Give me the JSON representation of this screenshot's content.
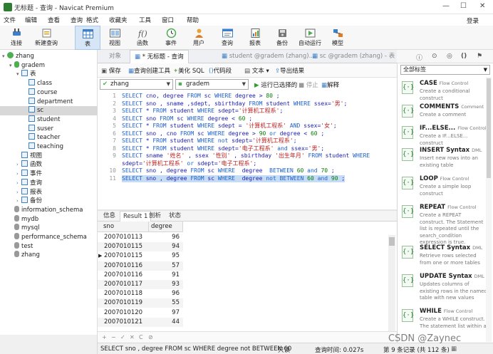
{
  "window": {
    "title": "无标题 - 查询 - Navicat Premium"
  },
  "menu": [
    "文件",
    "编辑",
    "查看",
    "查询",
    "格式",
    "收藏夹",
    "工具",
    "窗口",
    "帮助"
  ],
  "login_label": "登录",
  "toolbar": [
    {
      "label": "连接",
      "icon": "plug-icon"
    },
    {
      "label": "新建查询",
      "icon": "new-query-icon"
    },
    {
      "label": "表",
      "icon": "table-icon"
    },
    {
      "label": "视图",
      "icon": "view-icon"
    },
    {
      "label": "函数",
      "icon": "function-icon"
    },
    {
      "label": "事件",
      "icon": "clock-icon"
    },
    {
      "label": "用户",
      "icon": "user-icon"
    },
    {
      "label": "查询",
      "icon": "query-icon"
    },
    {
      "label": "报表",
      "icon": "report-icon"
    },
    {
      "label": "备份",
      "icon": "backup-icon"
    },
    {
      "label": "自动运行",
      "icon": "autorun-icon"
    },
    {
      "label": "模型",
      "icon": "model-icon"
    }
  ],
  "sidebar": {
    "items": [
      {
        "label": "zhang",
        "level": 0
      },
      {
        "label": "gradem",
        "level": 1
      },
      {
        "label": "表",
        "level": 2
      },
      {
        "label": "class",
        "level": 3
      },
      {
        "label": "course",
        "level": 3
      },
      {
        "label": "department",
        "level": 3
      },
      {
        "label": "sc",
        "level": 3
      },
      {
        "label": "student",
        "level": 3
      },
      {
        "label": "suser",
        "level": 3
      },
      {
        "label": "teacher",
        "level": 3
      },
      {
        "label": "teaching",
        "level": 3
      },
      {
        "label": "视图",
        "level": 2
      },
      {
        "label": "函数",
        "level": 2
      },
      {
        "label": "事件",
        "level": 2
      },
      {
        "label": "查询",
        "level": 2
      },
      {
        "label": "报表",
        "level": 2
      },
      {
        "label": "备份",
        "level": 2
      },
      {
        "label": "information_schema",
        "level": 1
      },
      {
        "label": "mydb",
        "level": 1
      },
      {
        "label": "mysql",
        "level": 1
      },
      {
        "label": "performance_schema",
        "level": 1
      },
      {
        "label": "test",
        "level": 1
      },
      {
        "label": "zhang",
        "level": 1
      }
    ]
  },
  "tabs": [
    "对象",
    "* 无标题 - 查询",
    "student @gradem (zhang)...",
    "sc @gradem (zhang) - 表"
  ],
  "query_toolbar": {
    "save": "保存",
    "builder": "查询创建工具",
    "beautify": "美化 SQL",
    "snippet": "代码段",
    "text": "文本",
    "export": "导出结果",
    "run_selected": "运行已选择的",
    "stop": "停止",
    "explain": "解释"
  },
  "selectors": {
    "connection": "zhang",
    "database": "gradem"
  },
  "editor": {
    "line_numbers": [
      "1",
      "2",
      "3",
      "4",
      "5",
      "6",
      "7",
      "8",
      "9",
      "",
      "10",
      "11"
    ],
    "lines": [
      [
        [
          "kw",
          "SELECT"
        ],
        [
          "tx",
          " cno, degree "
        ],
        [
          "kw",
          "FROM"
        ],
        [
          "tx",
          " sc "
        ],
        [
          "kw",
          "WHERE"
        ],
        [
          "tx",
          " degree > "
        ],
        [
          "num",
          "80"
        ],
        [
          "tx",
          " ;"
        ]
      ],
      [
        [
          "kw",
          "SELECT"
        ],
        [
          "tx",
          " sno , sname ,sdept, sbirthday "
        ],
        [
          "kw",
          "FROM"
        ],
        [
          "tx",
          " student "
        ],
        [
          "kw",
          "WHERE"
        ],
        [
          "tx",
          " ssex="
        ],
        [
          "st",
          "'男'"
        ],
        [
          "tx",
          ";"
        ]
      ],
      [
        [
          "kw",
          "SELECT"
        ],
        [
          "tx",
          " * "
        ],
        [
          "kw",
          "FROM"
        ],
        [
          "tx",
          " student "
        ],
        [
          "kw",
          "WHERE"
        ],
        [
          "tx",
          " sdept="
        ],
        [
          "st",
          "'计算机工程系'"
        ],
        [
          "tx",
          ";"
        ]
      ],
      [
        [
          "kw",
          "SELECT"
        ],
        [
          "tx",
          " sno "
        ],
        [
          "kw",
          "FROM"
        ],
        [
          "tx",
          " sc "
        ],
        [
          "kw",
          "WHERE"
        ],
        [
          "tx",
          " degree < "
        ],
        [
          "num",
          "60"
        ],
        [
          "tx",
          " ;"
        ]
      ],
      [
        [
          "kw",
          "SELECT"
        ],
        [
          "tx",
          " * "
        ],
        [
          "kw",
          "FROM"
        ],
        [
          "tx",
          " student "
        ],
        [
          "kw",
          "WHERE"
        ],
        [
          "tx",
          " sdept = "
        ],
        [
          "st",
          "'计算机工程系'"
        ],
        [
          "tx",
          " "
        ],
        [
          "kw",
          "AND"
        ],
        [
          "tx",
          " ssex="
        ],
        [
          "st",
          "'女'"
        ],
        [
          "tx",
          ";"
        ]
      ],
      [
        [
          "kw",
          "SELECT"
        ],
        [
          "tx",
          " sno , cno "
        ],
        [
          "kw",
          "FROM"
        ],
        [
          "tx",
          " sc "
        ],
        [
          "kw",
          "WHERE"
        ],
        [
          "tx",
          " degree > "
        ],
        [
          "num",
          "90"
        ],
        [
          "tx",
          " "
        ],
        [
          "kw",
          "or"
        ],
        [
          "tx",
          " degree < "
        ],
        [
          "num",
          "60"
        ],
        [
          "tx",
          " ;"
        ]
      ],
      [
        [
          "kw",
          "SELECT"
        ],
        [
          "tx",
          " * "
        ],
        [
          "kw",
          "FROM"
        ],
        [
          "tx",
          " student "
        ],
        [
          "kw",
          "WHERE"
        ],
        [
          "tx",
          " "
        ],
        [
          "kw",
          "not"
        ],
        [
          "tx",
          " sdept="
        ],
        [
          "st",
          "'计算机工程系'"
        ],
        [
          "tx",
          ";"
        ]
      ],
      [
        [
          "kw",
          "SELECT"
        ],
        [
          "tx",
          " * "
        ],
        [
          "kw",
          "FROM"
        ],
        [
          "tx",
          " student "
        ],
        [
          "kw",
          "WHERE"
        ],
        [
          "tx",
          " sdept="
        ],
        [
          "st",
          "'电子工程系'"
        ],
        [
          "tx",
          " "
        ],
        [
          "kw",
          "and"
        ],
        [
          "tx",
          " ssex="
        ],
        [
          "st",
          "'男'"
        ],
        [
          "tx",
          ";"
        ]
      ],
      [
        [
          "kw",
          "SELECT"
        ],
        [
          "tx",
          " sname "
        ],
        [
          "st",
          "'姓名'"
        ],
        [
          "tx",
          " , ssex "
        ],
        [
          "st",
          "'性别'"
        ],
        [
          "tx",
          " , sbirthday "
        ],
        [
          "st",
          "'出生年月'"
        ],
        [
          "tx",
          " "
        ],
        [
          "kw",
          "FROM"
        ],
        [
          "tx",
          " student "
        ],
        [
          "kw",
          "WHERE"
        ]
      ],
      [
        [
          "tx",
          "sdept="
        ],
        [
          "st",
          "'计算机工程系'"
        ],
        [
          "tx",
          " "
        ],
        [
          "kw",
          "or"
        ],
        [
          "tx",
          " sdept="
        ],
        [
          "st",
          "'电子工程系'"
        ],
        [
          "tx",
          ";"
        ]
      ],
      [
        [
          "kw",
          "SELECT"
        ],
        [
          "tx",
          " sno , degree "
        ],
        [
          "kw",
          "FROM"
        ],
        [
          "tx",
          " sc "
        ],
        [
          "kw",
          "WHERE"
        ],
        [
          "tx",
          "  degree  "
        ],
        [
          "kw",
          "BETWEEN"
        ],
        [
          "tx",
          " "
        ],
        [
          "num",
          "60"
        ],
        [
          "tx",
          " "
        ],
        [
          "kw",
          "and"
        ],
        [
          "tx",
          " "
        ],
        [
          "num",
          "70"
        ],
        [
          "tx",
          " ;"
        ]
      ],
      [
        [
          "kw",
          "SELECT"
        ],
        [
          "tx",
          " sno , degree "
        ],
        [
          "kw",
          "FROM"
        ],
        [
          "tx",
          " sc "
        ],
        [
          "kw",
          "WHERE"
        ],
        [
          "tx",
          "  degree "
        ],
        [
          "kw",
          "not"
        ],
        [
          "tx",
          " "
        ],
        [
          "kw",
          "BETWEEN"
        ],
        [
          "tx",
          " "
        ],
        [
          "num",
          "60"
        ],
        [
          "tx",
          " "
        ],
        [
          "kw",
          "and"
        ],
        [
          "tx",
          " "
        ],
        [
          "num",
          "90"
        ],
        [
          "tx",
          " ;"
        ]
      ]
    ],
    "highlighted_line": 11
  },
  "result_tabs": [
    "信息",
    "Result 1",
    "剖析",
    "状态"
  ],
  "grid": {
    "columns": [
      "sno",
      "degree"
    ],
    "rows": [
      [
        "2007010113",
        "96"
      ],
      [
        "2007010115",
        "94"
      ],
      [
        "2007010115",
        "95"
      ],
      [
        "2007010116",
        "57"
      ],
      [
        "2007010116",
        "91"
      ],
      [
        "2007010117",
        "93"
      ],
      [
        "2007010118",
        "96"
      ],
      [
        "2007010119",
        "55"
      ],
      [
        "2007010120",
        "97"
      ],
      [
        "2007010121",
        "44"
      ]
    ],
    "current_row": 2,
    "footer_buttons": [
      "+",
      "−",
      "✓",
      "✕",
      "C",
      "⊘"
    ]
  },
  "status": {
    "sql": "SELECT sno , degree FROM sc WHERE  degree not BETWEEN 60",
    "mode": "只读",
    "time": "查询时间: 0.027s",
    "record": "第 9 条记录 (共 112 条)"
  },
  "right_panel": {
    "filter": "全部标签",
    "snippets": [
      {
        "title": "CASE",
        "tag": "Flow Control",
        "desc": "Create a conditional construct"
      },
      {
        "title": "COMMENTS",
        "tag": "Comment",
        "desc": "Create a comment"
      },
      {
        "title": "IF...ELSE...",
        "tag": "Flow Control",
        "desc": "Create a IF...ELSE... construct"
      },
      {
        "title": "INSERT Syntax",
        "tag": "DML",
        "desc": "Insert new rows into an existing table"
      },
      {
        "title": "LOOP",
        "tag": "Flow Control",
        "desc": "Create a simple loop construct"
      },
      {
        "title": "REPEAT",
        "tag": "Flow Control",
        "desc": "Create a REPEAT construct. The Statement list is repeated until the search_condition expression is true."
      },
      {
        "title": "SELECT Syntax",
        "tag": "DML",
        "desc": "Retrieve rows selected from one or more tables"
      },
      {
        "title": "UPDATE Syntax",
        "tag": "DML",
        "desc": "Updates columns of existing rows in the named table with new values"
      },
      {
        "title": "WHILE",
        "tag": "Flow Control",
        "desc": "Create a WHILE construct. The statement list within a"
      }
    ]
  },
  "watermark": "CSDN @Zaynec",
  "colors": {
    "keyword": "#1d5fcf",
    "string": "#c02222",
    "number": "#0a7d0a",
    "selection": "#c6dcf4",
    "tree_selected": "#d8d8d8",
    "snippet_icon": "#2e7d32"
  }
}
